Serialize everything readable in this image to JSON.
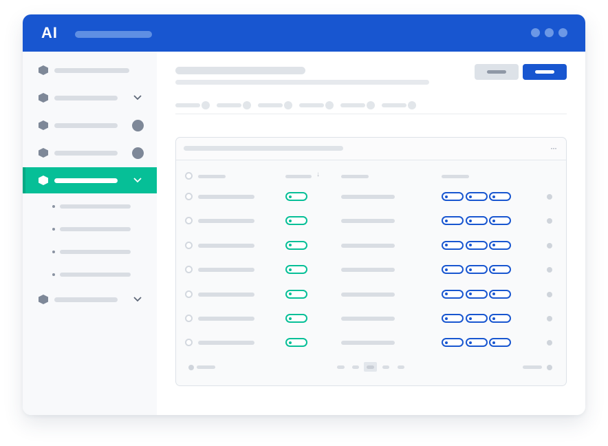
{
  "app": {
    "logo_text": "AI",
    "colors": {
      "brand_blue": "#1856d0",
      "accent_green": "#06bf97",
      "placeholder_gray": "#d9dde3"
    }
  },
  "titlebar": {
    "window_control_icons": [
      "dot-icon",
      "dot-icon",
      "dot-icon"
    ]
  },
  "sidebar": {
    "items": [
      {
        "icon": "hexagon-icon",
        "trailing": "none",
        "active": false
      },
      {
        "icon": "hexagon-icon",
        "trailing": "chevron-down-icon",
        "active": false
      },
      {
        "icon": "hexagon-icon",
        "trailing": "badge",
        "active": false
      },
      {
        "icon": "hexagon-icon",
        "trailing": "badge",
        "active": false
      },
      {
        "icon": "hexagon-icon",
        "trailing": "chevron-down-icon",
        "active": true,
        "sub_items": [
          {},
          {},
          {},
          {}
        ]
      },
      {
        "icon": "hexagon-icon",
        "trailing": "chevron-down-icon",
        "active": false
      }
    ]
  },
  "main": {
    "buttons": [
      {
        "style": "secondary"
      },
      {
        "style": "primary"
      }
    ],
    "tabs_count": 6,
    "table": {
      "more_icon": "more-horizontal-icon",
      "sort_icon": "arrow-down-icon",
      "more_glyph": "···",
      "sort_glyph": "↓",
      "row_count": 7,
      "tags_per_row": 3
    }
  }
}
